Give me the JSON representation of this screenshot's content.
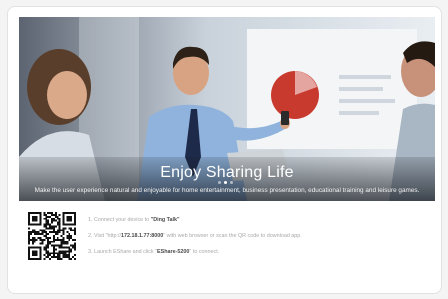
{
  "banner": {
    "headline": "Enjoy Sharing Life",
    "subline": "Make the user experience natural and enjoyable for home entertainment, business presentation, educational training and leisure games.",
    "dots": 3,
    "active_dot": 1
  },
  "qr_code": {
    "icon": "qr-code-icon"
  },
  "steps": [
    {
      "prefix": "1. Connect your device to ",
      "strong": "\"Ding Talk\"",
      "suffix": ""
    },
    {
      "prefix": "2. Visit \"http://",
      "strong": "172.18.1.77:8000",
      "suffix": "\" with web browser or scan the QR code to download app."
    },
    {
      "prefix": "3. Launch EShare and click \"",
      "strong": "EShare-5200",
      "suffix": "\" to connect."
    }
  ],
  "colors": {
    "accent_red": "#c93a2e",
    "shirt_blue": "#8fb3dc",
    "tie_navy": "#1e2a4a"
  }
}
